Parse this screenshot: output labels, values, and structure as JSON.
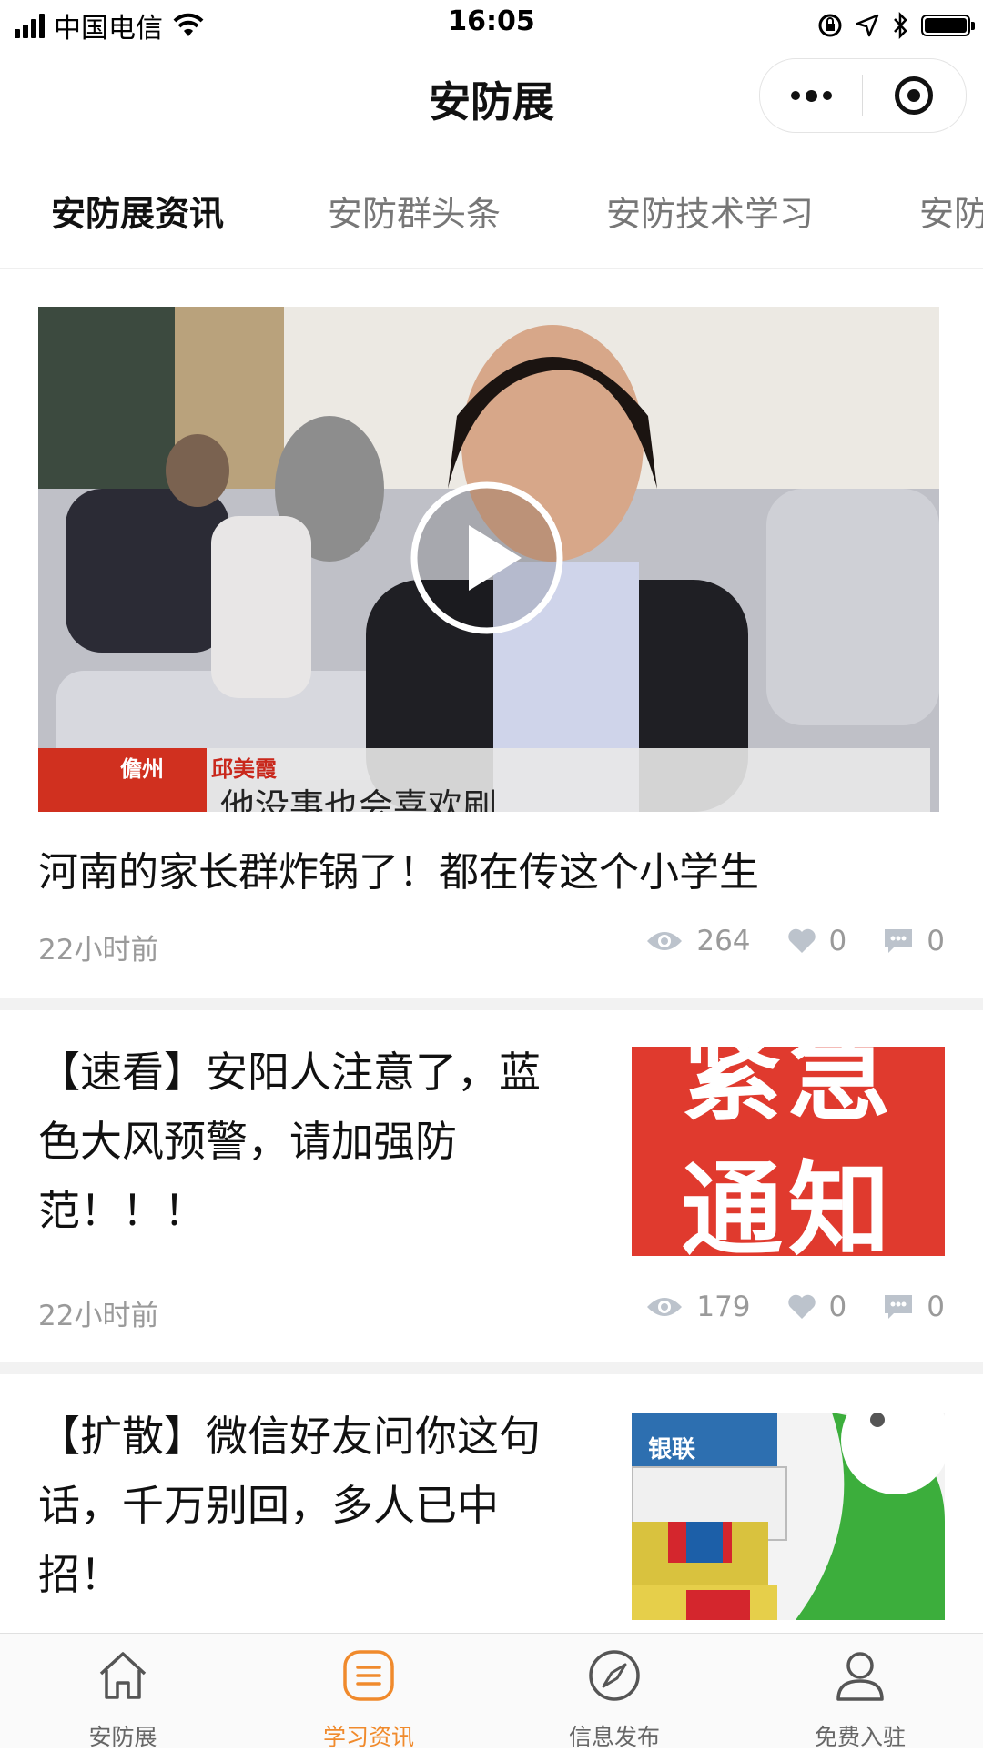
{
  "status_bar": {
    "carrier": "中国电信",
    "time": "16:05"
  },
  "header": {
    "title": "安防展"
  },
  "tabs": [
    {
      "label": "安防展资讯",
      "active": true
    },
    {
      "label": "安防群头条",
      "active": false
    },
    {
      "label": "安防技术学习",
      "active": false
    },
    {
      "label": "安防",
      "active": false
    }
  ],
  "articles": [
    {
      "title": "河南的家长群炸锅了！都在传这个小学生",
      "time": "22小时前",
      "views": "264",
      "likes": "0",
      "comments": "0",
      "video_caption": {
        "location": "儋州",
        "name": "邱美霞",
        "subtitle": "他没事也会喜欢刷"
      }
    },
    {
      "title": "【速看】安阳人注意了，蓝色大风预警，请加强防范！！！",
      "time": "22小时前",
      "views": "179",
      "likes": "0",
      "comments": "0",
      "thumb_line1": "紧急",
      "thumb_line2": "通知"
    },
    {
      "title": "【扩散】微信好友问你这句话，千万别回，多人已中招！",
      "thumb_text": "银联"
    }
  ],
  "bottom_nav": [
    {
      "label": "安防展",
      "icon": "home-icon",
      "active": false
    },
    {
      "label": "学习资讯",
      "icon": "news-list-icon",
      "active": true
    },
    {
      "label": "信息发布",
      "icon": "compass-icon",
      "active": false
    },
    {
      "label": "免费入驻",
      "icon": "user-icon",
      "active": false
    }
  ],
  "colors": {
    "accent": "#f08a2c",
    "meta_gray": "#9a9a9a",
    "icon_gray": "#bcc3cc",
    "alert_red": "#e03a2e"
  }
}
